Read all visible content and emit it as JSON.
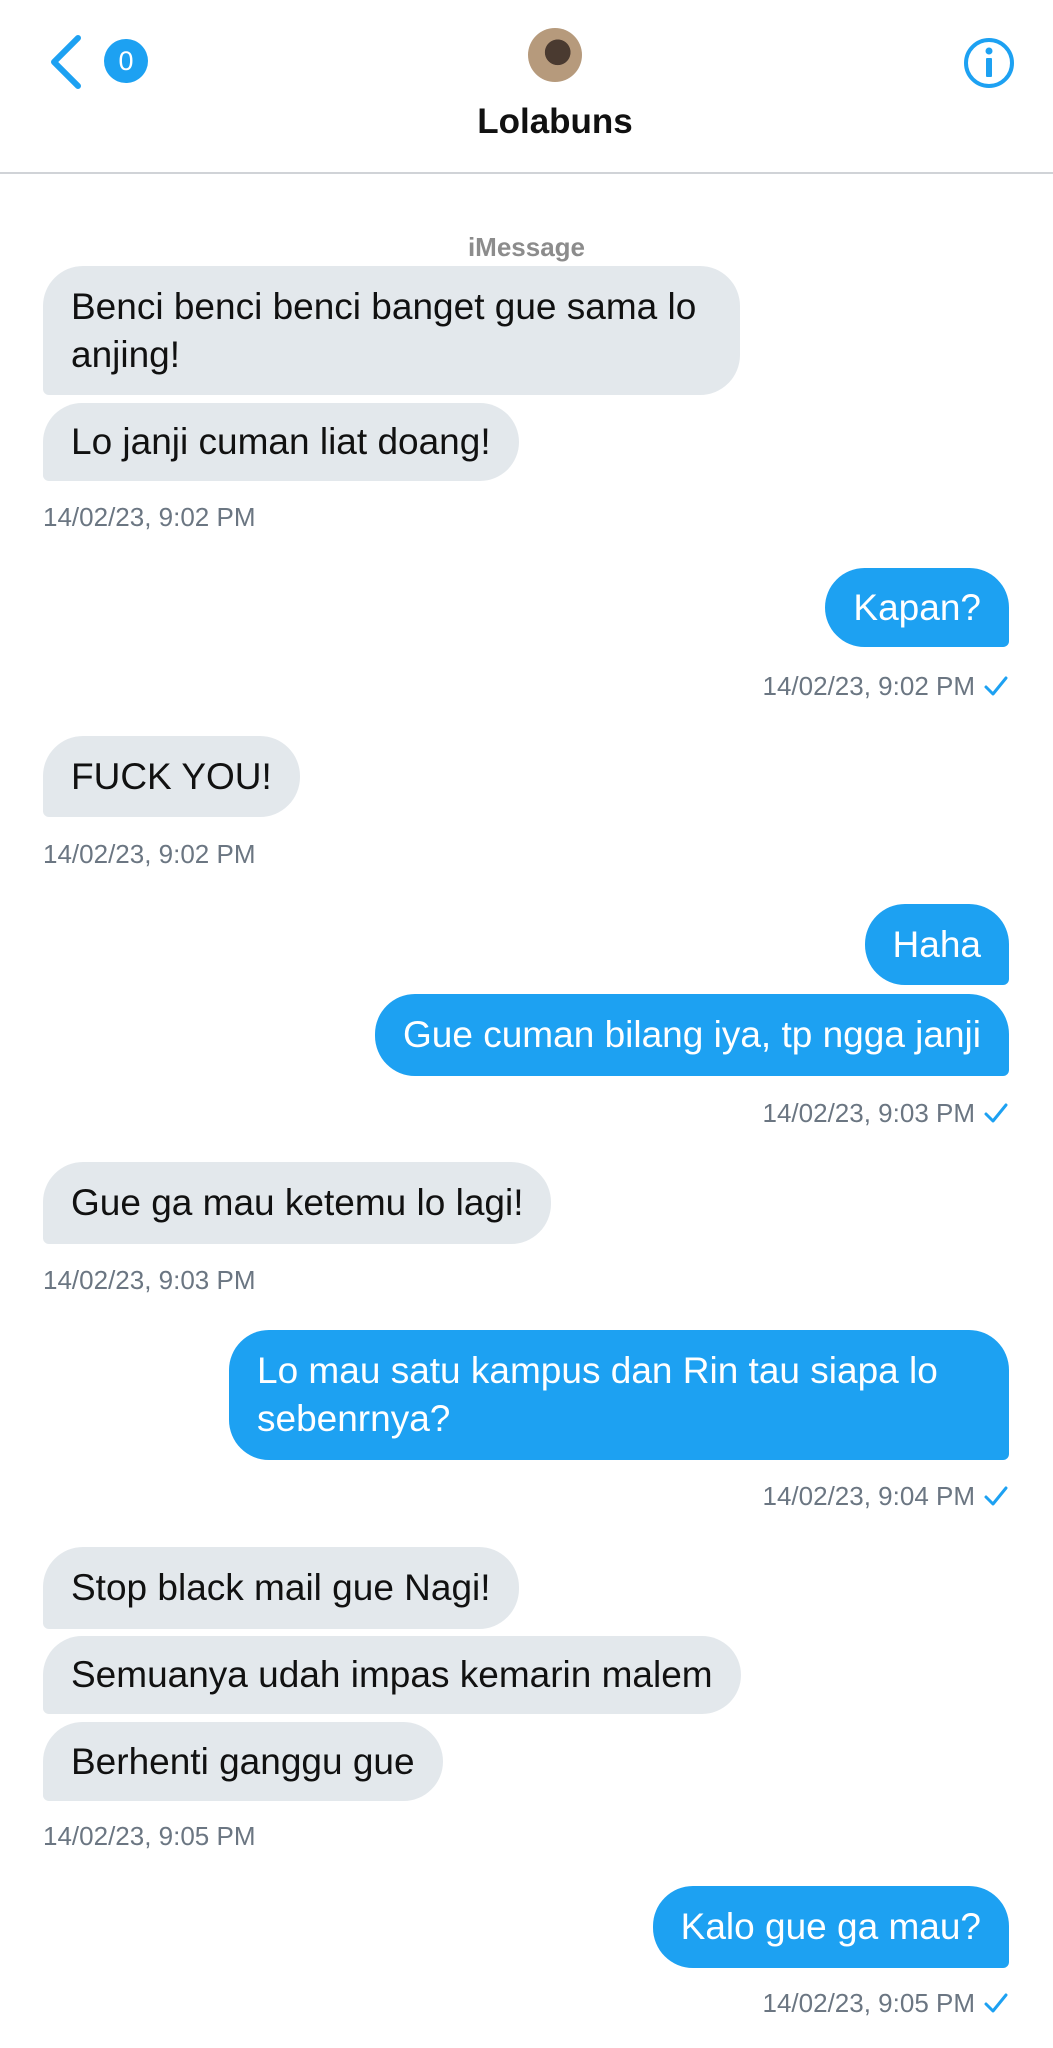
{
  "header": {
    "unread_count": "0",
    "contact_name": "Lolabuns",
    "icons": {
      "back": "chevron-left-icon",
      "info": "info-circle-icon",
      "avatar": "contact-avatar"
    },
    "accent_color": "#1da1f2"
  },
  "service_label": "iMessage",
  "messages": [
    {
      "direction": "in",
      "text": "Benci benci benci banget gue sama lo anjing!"
    },
    {
      "direction": "in",
      "text": "Lo janji cuman liat doang!"
    },
    {
      "direction": "in",
      "timestamp": "14/02/23, 9:02 PM"
    },
    {
      "direction": "out",
      "text": "Kapan?"
    },
    {
      "direction": "out",
      "timestamp": "14/02/23, 9:02 PM",
      "status": "read-check"
    },
    {
      "direction": "in",
      "text": "FUCK YOU!"
    },
    {
      "direction": "in",
      "timestamp": "14/02/23, 9:02 PM"
    },
    {
      "direction": "out",
      "text": "Haha"
    },
    {
      "direction": "out",
      "text": "Gue cuman bilang iya, tp ngga janji"
    },
    {
      "direction": "out",
      "timestamp": "14/02/23, 9:03 PM",
      "status": "read-check"
    },
    {
      "direction": "in",
      "text": "Gue ga mau ketemu lo lagi!"
    },
    {
      "direction": "in",
      "timestamp": "14/02/23, 9:03 PM"
    },
    {
      "direction": "out",
      "text": "Lo mau satu kampus dan Rin tau siapa lo sebenrnya?"
    },
    {
      "direction": "out",
      "timestamp": "14/02/23, 9:04 PM",
      "status": "read-check"
    },
    {
      "direction": "in",
      "text": "Stop black mail gue Nagi!"
    },
    {
      "direction": "in",
      "text": "Semuanya udah impas kemarin malem"
    },
    {
      "direction": "in",
      "text": "Berhenti ganggu gue"
    },
    {
      "direction": "in",
      "timestamp": "14/02/23, 9:05 PM"
    },
    {
      "direction": "out",
      "text": "Kalo gue ga mau?"
    },
    {
      "direction": "out",
      "timestamp": "14/02/23, 9:05 PM",
      "status": "read-check"
    }
  ]
}
